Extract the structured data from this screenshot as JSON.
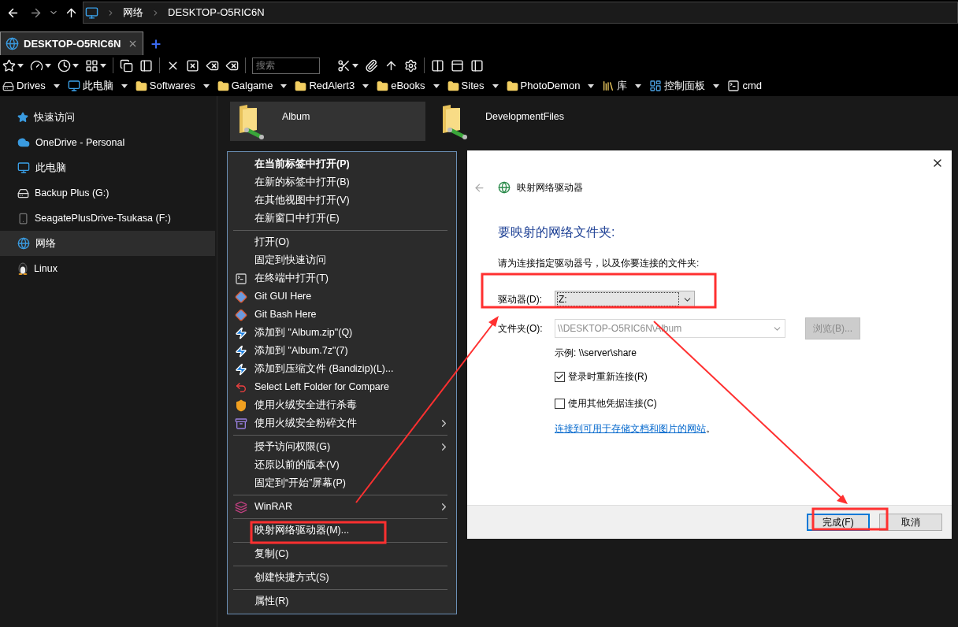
{
  "nav": {
    "address": [
      "网络",
      "DESKTOP-O5RIC6N"
    ]
  },
  "tabs": [
    {
      "label": "DESKTOP-O5RIC6N",
      "selected": true
    }
  ],
  "search": {
    "placeholder": "搜索"
  },
  "bookmarks": [
    {
      "label": "Drives",
      "dropdown": true
    },
    {
      "label": "此电脑",
      "dropdown": true
    },
    {
      "label": "Softwares",
      "dropdown": true
    },
    {
      "label": "Galgame",
      "dropdown": true
    },
    {
      "label": "RedAlert3",
      "dropdown": true
    },
    {
      "label": "eBooks",
      "dropdown": true
    },
    {
      "label": "Sites",
      "dropdown": true
    },
    {
      "label": "PhotoDemon",
      "dropdown": true
    },
    {
      "label": "库",
      "dropdown": true
    },
    {
      "label": "控制面板",
      "dropdown": true
    },
    {
      "label": "cmd",
      "dropdown": false
    }
  ],
  "sidebar": {
    "items": [
      {
        "label": "快速访问",
        "selected": false
      },
      {
        "label": "OneDrive - Personal",
        "selected": false
      },
      {
        "label": "此电脑",
        "selected": false
      },
      {
        "label": "Backup Plus (G:)",
        "selected": false
      },
      {
        "label": "SeagatePlusDrive-Tsukasa (F:)",
        "selected": false
      },
      {
        "label": "网络",
        "selected": true
      },
      {
        "label": "Linux",
        "selected": false
      }
    ]
  },
  "folders": [
    {
      "name": "Album",
      "selected": true
    },
    {
      "name": "DevelopmentFiles",
      "selected": false
    }
  ],
  "context_menu": {
    "items": [
      {
        "kind": "item",
        "label": "在当前标签中打开(P)",
        "default": true,
        "submenu": false
      },
      {
        "kind": "item",
        "label": "在新的标签中打开(B)",
        "default": false,
        "submenu": false
      },
      {
        "kind": "item",
        "label": "在其他视图中打开(V)",
        "default": false,
        "submenu": false
      },
      {
        "kind": "item",
        "label": "在新窗口中打开(E)",
        "default": false,
        "submenu": false
      },
      {
        "kind": "separator"
      },
      {
        "kind": "item",
        "label": "打开(O)",
        "default": false,
        "submenu": false
      },
      {
        "kind": "item",
        "label": "固定到快速访问",
        "default": false,
        "submenu": false
      },
      {
        "kind": "item",
        "label": "在终端中打开(T)",
        "default": false,
        "submenu": false
      },
      {
        "kind": "item",
        "label": "Git GUI Here",
        "default": false,
        "submenu": false
      },
      {
        "kind": "item",
        "label": "Git Bash Here",
        "default": false,
        "submenu": false
      },
      {
        "kind": "item",
        "label": "添加到 \"Album.zip\"(Q)",
        "default": false,
        "submenu": false
      },
      {
        "kind": "item",
        "label": "添加到 \"Album.7z\"(7)",
        "default": false,
        "submenu": false
      },
      {
        "kind": "item",
        "label": "添加到压缩文件 (Bandizip)(L)...",
        "default": false,
        "submenu": false
      },
      {
        "kind": "item",
        "label": "Select Left Folder for Compare",
        "default": false,
        "submenu": false
      },
      {
        "kind": "item",
        "label": "使用火绒安全进行杀毒",
        "default": false,
        "submenu": false
      },
      {
        "kind": "item",
        "label": "使用火绒安全粉碎文件",
        "default": false,
        "submenu": true
      },
      {
        "kind": "separator"
      },
      {
        "kind": "item",
        "label": "授予访问权限(G)",
        "default": false,
        "submenu": true
      },
      {
        "kind": "item",
        "label": "还原以前的版本(V)",
        "default": false,
        "submenu": false
      },
      {
        "kind": "item",
        "label": "固定到“开始”屏幕(P)",
        "default": false,
        "submenu": false
      },
      {
        "kind": "separator"
      },
      {
        "kind": "item",
        "label": "WinRAR",
        "default": false,
        "submenu": true
      },
      {
        "kind": "separator"
      },
      {
        "kind": "item",
        "label": "映射网络驱动器(M)...",
        "default": false,
        "submenu": false
      },
      {
        "kind": "separator"
      },
      {
        "kind": "item",
        "label": "复制(C)",
        "default": false,
        "submenu": false
      },
      {
        "kind": "separator"
      },
      {
        "kind": "item",
        "label": "创建快捷方式(S)",
        "default": false,
        "submenu": false
      },
      {
        "kind": "separator"
      },
      {
        "kind": "item",
        "label": "属性(R)",
        "default": false,
        "submenu": false
      }
    ]
  },
  "dialog": {
    "title": "映射网络驱动器",
    "heading": "要映射的网络文件夹:",
    "instruction": "请为连接指定驱动器号，以及你要连接的文件夹:",
    "drive": {
      "label": "驱动器(D):",
      "value": "Z:"
    },
    "folder": {
      "label": "文件夹(O):",
      "value": "\\\\DESKTOP-O5RIC6N\\Album",
      "disabled": true
    },
    "browse": {
      "label": "浏览(B)...",
      "disabled": true
    },
    "example": "示例: \\\\server\\share",
    "options": [
      {
        "label": "登录时重新连接(R)",
        "checked": true
      },
      {
        "label": "使用其他凭据连接(C)",
        "checked": false
      }
    ],
    "link": "连接到可用于存储文档和图片的网站",
    "link_suffix": "。",
    "buttons": [
      {
        "label": "完成(F)",
        "default": true
      },
      {
        "label": "取消",
        "default": false
      }
    ]
  }
}
